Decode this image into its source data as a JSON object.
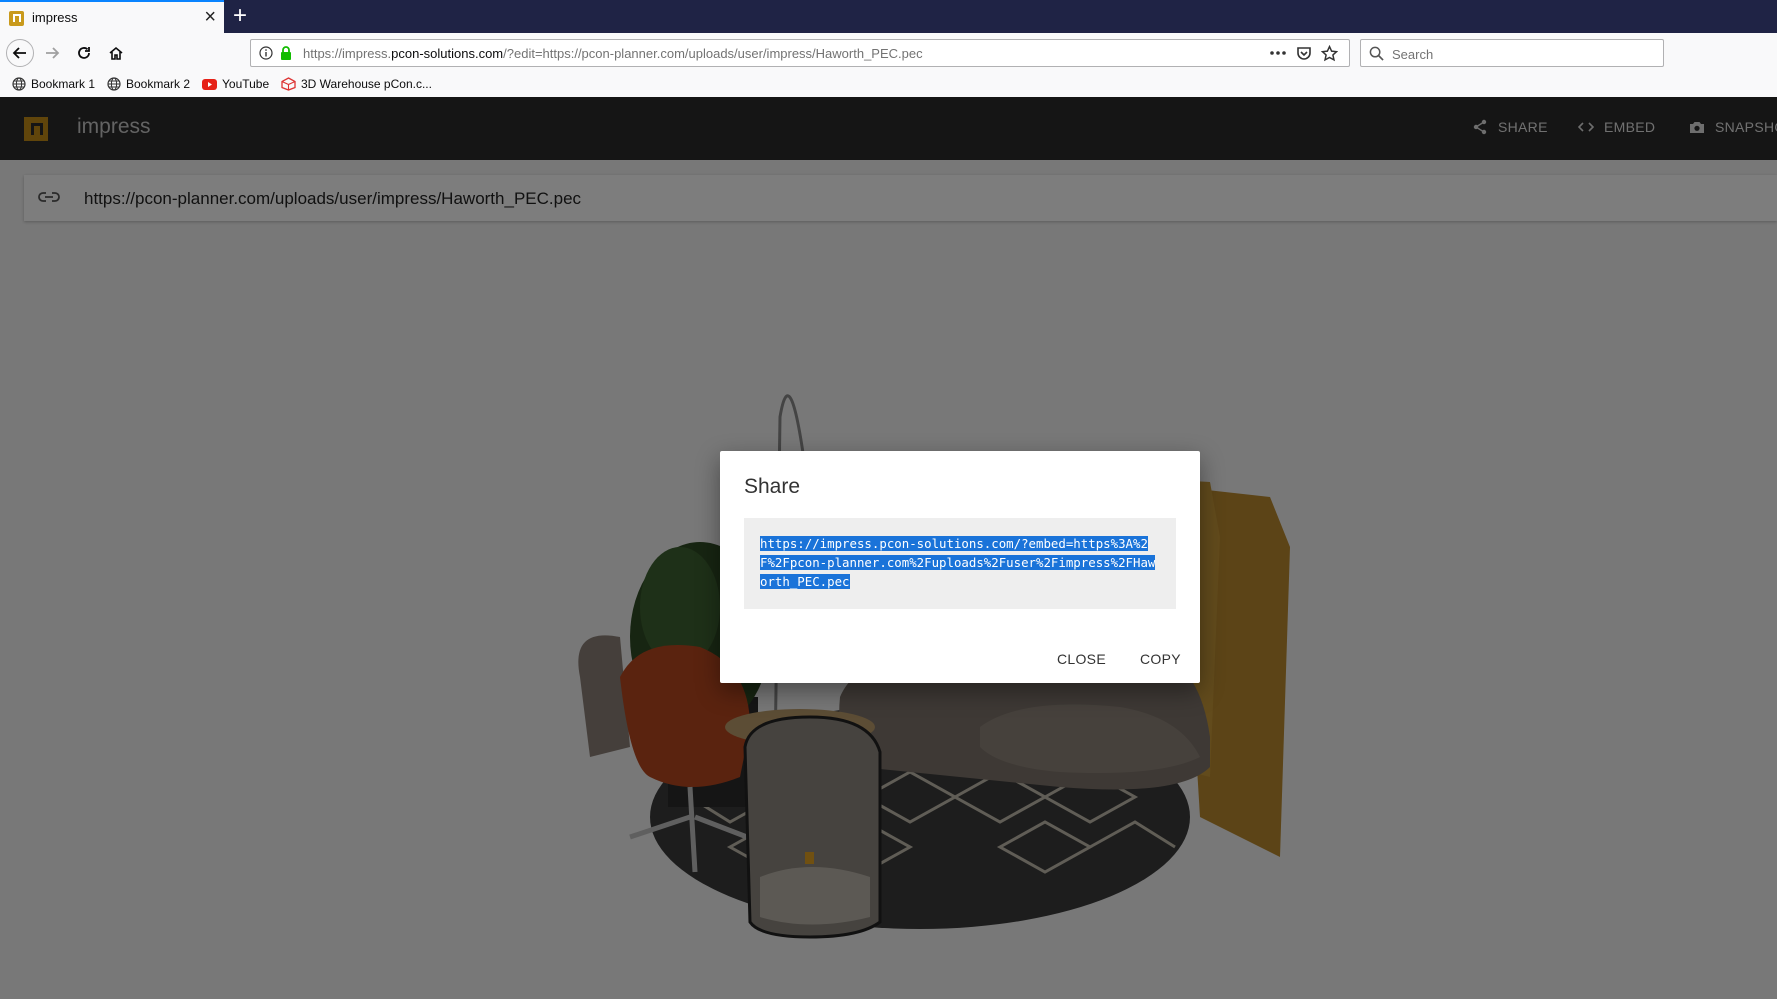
{
  "browser": {
    "tab": {
      "title": "impress"
    },
    "url": {
      "prefix": "https://impress.",
      "host": "pcon-solutions.com",
      "suffix": "/?edit=https://pcon-planner.com/uploads/user/impress/Haworth_PEC.pec"
    },
    "search": {
      "placeholder": "Search"
    },
    "bookmarks": [
      {
        "label": "Bookmark 1",
        "icon": "globe-icon"
      },
      {
        "label": "Bookmark 2",
        "icon": "globe-icon"
      },
      {
        "label": "YouTube",
        "icon": "youtube-icon"
      },
      {
        "label": "3D Warehouse pCon.c...",
        "icon": "warehouse-icon"
      }
    ]
  },
  "app": {
    "name": "impress",
    "actions": {
      "share": "SHARE",
      "embed": "EMBED",
      "snapshot": "SNAPSHO"
    },
    "model_url": "https://pcon-planner.com/uploads/user/impress/Haworth_PEC.pec"
  },
  "dialog": {
    "title": "Share",
    "share_url": "https://impress.pcon-solutions.com/?embed=https%3A%2F%2Fpcon-planner.com%2Fuploads%2Fuser%2Fimpress%2FHaworth_PEC.pec",
    "close_label": "CLOSE",
    "copy_label": "COPY"
  },
  "colors": {
    "brand": "#c08a17",
    "header_bg": "#2b2b2b",
    "selection": "#1a73d9",
    "tab_accent": "#0a84ff"
  }
}
